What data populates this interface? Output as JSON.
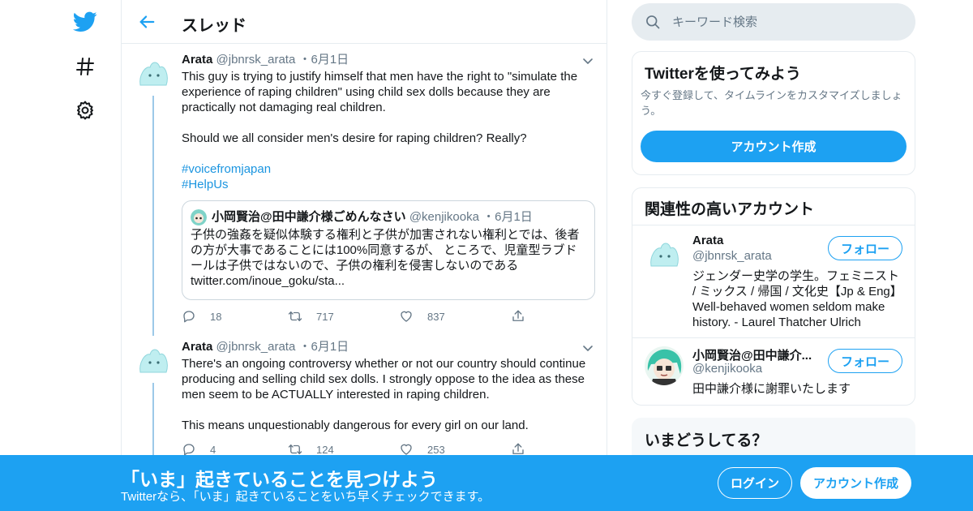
{
  "colors": {
    "accent": "#1da1f2",
    "link": "#1b95e0",
    "muted": "#657786",
    "border": "#e6ecf0"
  },
  "nav": {
    "items": [
      {
        "icon": "twitter-bird-icon"
      },
      {
        "icon": "hashtag-icon"
      },
      {
        "icon": "gear-icon"
      }
    ]
  },
  "header": {
    "title": "スレッド"
  },
  "tweets": [
    {
      "name": "Arata",
      "handle": "@jbnrsk_arata",
      "dot": "・",
      "date": "6月1日",
      "text": "This guy is trying to justify himself that men have the right to \"simulate the experience of raping children\" using child sex dolls because they are practically not damaging real children.\n\nShould we all consider men's desire for raping children? Really?",
      "hashtags": [
        "#voicefromjapan",
        "#HelpUs"
      ],
      "quote": {
        "name": "小岡賢治@田中謙介様ごめんなさい",
        "handle": "@kenjikooka",
        "dot": "・",
        "date": "6月1日",
        "text": "子供の強姦を疑似体験する権利と子供が加害されない権利とでは、後者の方が大事であることには100%同意するが、\nところで、児童型ラブドールは子供ではないので、子供の権利を侵害しないのである twitter.com/inoue_goku/sta..."
      },
      "replies": "18",
      "retweets": "717",
      "likes": "837"
    },
    {
      "name": "Arata",
      "handle": "@jbnrsk_arata",
      "dot": "・",
      "date": "6月1日",
      "text": "There's an ongoing controversy whether or not our country should continue producing and selling child sex dolls. I strongly oppose to the idea as these men seem to be ACTUALLY interested in raping children.\n\nThis means unquestionably dangerous for every girl on our land.",
      "replies": "4",
      "retweets": "124",
      "likes": "253"
    }
  ],
  "search": {
    "placeholder": "キーワード検索"
  },
  "signup_card": {
    "title": "Twitterを使ってみよう",
    "desc": "今すぐ登録して、タイムラインをカスタマイズしましょう。",
    "button": "アカウント作成"
  },
  "related_card": {
    "title": "関連性の高いアカウント",
    "accounts": [
      {
        "name": "Arata",
        "handle": "@jbnrsk_arata",
        "bio": "ジェンダー史学の学生。フェミニスト / ミックス / 帰国 / 文化史【Jp & Eng】Well-behaved women seldom make history. - Laurel Thatcher Ulrich",
        "follow": "フォロー"
      },
      {
        "name": "小岡賢治@田中謙介...",
        "handle": "@kenjikooka",
        "bio": "田中謙介様に謝罪いたします",
        "follow": "フォロー"
      }
    ]
  },
  "trends_card": {
    "title": "いまどうしてる？"
  },
  "bottom_bar": {
    "title": "「いま」起きていることを見つけよう",
    "subtitle": "Twitterなら、「いま」起きていることをいち早くチェックできます。",
    "login": "ログイン",
    "signup": "アカウント作成"
  }
}
